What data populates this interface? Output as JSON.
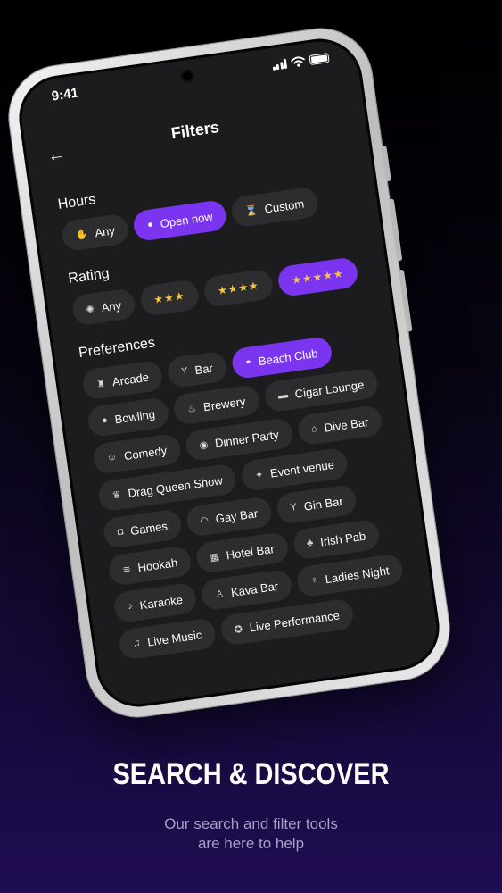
{
  "status": {
    "time": "9:41"
  },
  "header": {
    "title": "Filters",
    "back_icon": "arrow-left-icon"
  },
  "sections": [
    {
      "title": "Hours",
      "chips": [
        {
          "label": "Any",
          "icon": "✋",
          "active": false
        },
        {
          "label": "Open now",
          "icon": "●",
          "active": true
        },
        {
          "label": "Custom",
          "icon": "⌛",
          "active": false
        }
      ]
    },
    {
      "title": "Rating",
      "chips": [
        {
          "label": "Any",
          "icon": "✺",
          "active": false
        },
        {
          "label": "",
          "icon": "★★★",
          "active": false,
          "stars": true
        },
        {
          "label": "",
          "icon": "★★★★",
          "active": false,
          "stars": true
        },
        {
          "label": "",
          "icon": "★★★★★",
          "active": true,
          "stars": true
        }
      ]
    },
    {
      "title": "Preferences",
      "chips": [
        {
          "label": "Arcade",
          "icon": "♜",
          "active": false
        },
        {
          "label": "Bar",
          "icon": "Y",
          "active": false
        },
        {
          "label": "Beach Club",
          "icon": "◓",
          "active": true
        },
        {
          "label": "Bowling",
          "icon": "●",
          "active": false
        },
        {
          "label": "Brewery",
          "icon": "♨",
          "active": false
        },
        {
          "label": "Cigar Lounge",
          "icon": "▬",
          "active": false
        },
        {
          "label": "Comedy",
          "icon": "☺",
          "active": false
        },
        {
          "label": "Dinner Party",
          "icon": "◉",
          "active": false
        },
        {
          "label": "Dive Bar",
          "icon": "⌂",
          "active": false
        },
        {
          "label": "Drag Queen Show",
          "icon": "♛",
          "active": false
        },
        {
          "label": "Event venue",
          "icon": "✦",
          "active": false
        },
        {
          "label": "Games",
          "icon": "◘",
          "active": false
        },
        {
          "label": "Gay Bar",
          "icon": "◠",
          "active": false
        },
        {
          "label": "Gin Bar",
          "icon": "Y",
          "active": false
        },
        {
          "label": "Hookah",
          "icon": "≋",
          "active": false
        },
        {
          "label": "Hotel Bar",
          "icon": "▦",
          "active": false
        },
        {
          "label": "Irish Pab",
          "icon": "♣",
          "active": false
        },
        {
          "label": "Karaoke",
          "icon": "♪",
          "active": false
        },
        {
          "label": "Kava Bar",
          "icon": "♙",
          "active": false
        },
        {
          "label": "Ladies Night",
          "icon": "♀",
          "active": false
        },
        {
          "label": "Live Music",
          "icon": "♫",
          "active": false
        },
        {
          "label": "Live Performance",
          "icon": "✪",
          "active": false
        }
      ]
    }
  ],
  "caption": {
    "title": "SEARCH & DISCOVER",
    "line1": "Our search and filter tools",
    "line2": "are here to help"
  },
  "colors": {
    "accent": "#7b35f0",
    "chip_bg": "#2d2d30",
    "screen_bg": "#1c1c1e"
  }
}
